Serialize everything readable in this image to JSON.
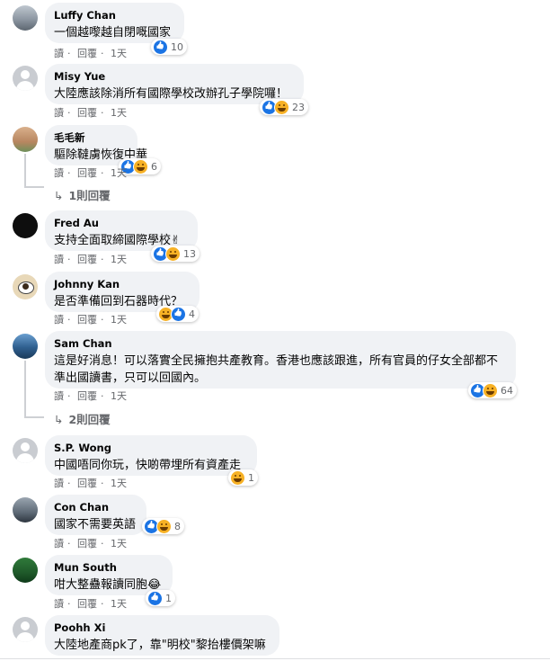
{
  "common": {
    "reply_action": "讀",
    "reply_label": "回覆",
    "time_label": "1天",
    "dot": "·"
  },
  "comments": [
    {
      "author": "Luffy Chan",
      "text": "一個越嚟越自閉嘅國家",
      "reactions": [
        "like"
      ],
      "count": "10",
      "replies": ""
    },
    {
      "author": "Misy Yue",
      "text": "大陸應該除消所有國際學校改辦孔子學院囉！",
      "reactions": [
        "like",
        "haha"
      ],
      "count": "23",
      "replies": ""
    },
    {
      "author": "毛毛新",
      "text": "驅除韃虜恢復中華",
      "reactions": [
        "like",
        "haha"
      ],
      "count": "6",
      "replies": "1則回覆"
    },
    {
      "author": "Fred Au",
      "text": "支持全面取締國際學校✌",
      "reactions": [
        "like",
        "haha"
      ],
      "count": "13",
      "replies": ""
    },
    {
      "author": "Johnny Kan",
      "text": "是否準備回到石器時代？",
      "reactions": [
        "haha",
        "like"
      ],
      "count": "4",
      "replies": ""
    },
    {
      "author": "Sam Chan",
      "text": "這是好消息！可以落實全民擁抱共產教育。香港也應該跟進，所有官員的仔女全部都不準出國讀書，只可以回國內。",
      "reactions": [
        "like",
        "haha"
      ],
      "count": "64",
      "replies": "2則回覆"
    },
    {
      "author": "S.P. Wong",
      "text": "中國唔同你玩，快啲帶埋所有資產走",
      "reactions": [
        "haha"
      ],
      "count": "1",
      "replies": ""
    },
    {
      "author": "Con Chan",
      "text": "國家不需要英語",
      "reactions": [
        "like",
        "haha"
      ],
      "count": "8",
      "replies": ""
    },
    {
      "author": "Mun South",
      "text": "咁大整蠱報讀同胞😂",
      "reactions": [
        "like"
      ],
      "count": "1",
      "replies": ""
    },
    {
      "author": "Poohh Xi",
      "text": "大陸地產商pk了，靠\"明校\"黎抬樓價架嘛",
      "reactions": [],
      "count": "",
      "replies": ""
    }
  ],
  "colors": {
    "bubble": "#f0f2f5",
    "meta": "#65676b",
    "like": "#1b74e4",
    "haha": "#f7b125"
  }
}
